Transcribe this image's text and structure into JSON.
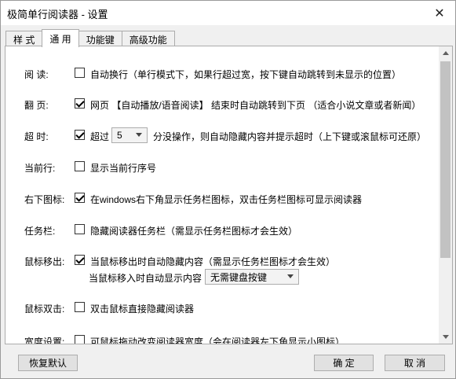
{
  "window": {
    "title": "极简单行阅读器 - 设置",
    "close_glyph": "✕"
  },
  "tabs": [
    {
      "label": "样 式"
    },
    {
      "label": "通 用"
    },
    {
      "label": "功能键"
    },
    {
      "label": "高级功能"
    }
  ],
  "settings": {
    "read": {
      "label": "阅 读:",
      "checked": false,
      "text": "自动换行（单行模式下，如果行超过宽，按下键自动跳转到未显示的位置）"
    },
    "page": {
      "label": "翻 页:",
      "checked": true,
      "text": "网页 【自动播放/语音阅读】 结束时自动跳转到下页 （适合小说文章或者新闻）"
    },
    "timeout": {
      "label": "超 时:",
      "checked": true,
      "prefix": "超过",
      "select_value": "5",
      "suffix": "分没操作，则自动隐藏内容并提示超时（上下键或滚鼠标可还原）"
    },
    "current_line": {
      "label": "当前行:",
      "checked": false,
      "text": "显示当前行序号"
    },
    "tray_icon": {
      "label": "右下图标:",
      "checked": true,
      "text": "在windows右下角显示任务栏图标，双击任务栏图标可显示阅读器"
    },
    "taskbar": {
      "label": "任务栏:",
      "checked": false,
      "text": "隐藏阅读器任务栏（需显示任务栏图标才会生效）"
    },
    "mouse_out": {
      "label": "鼠标移出:",
      "checked": true,
      "text": "当鼠标移出时自动隐藏内容（需显示任务栏图标才会生效）",
      "sub_text": "当鼠标移入时自动显示内容",
      "select_value": "无需键盘按键"
    },
    "dblclick": {
      "label": "鼠标双击:",
      "checked": false,
      "text": "双击鼠标直接隐藏阅读器"
    },
    "partial": {
      "label": "宽度设置:",
      "checked": false,
      "text": "可鼠标拖动改变阅读器宽度（会在阅读器左下角显示小图标）"
    }
  },
  "buttons": {
    "reset": "恢复默认",
    "ok": "确 定",
    "cancel": "取 消"
  }
}
